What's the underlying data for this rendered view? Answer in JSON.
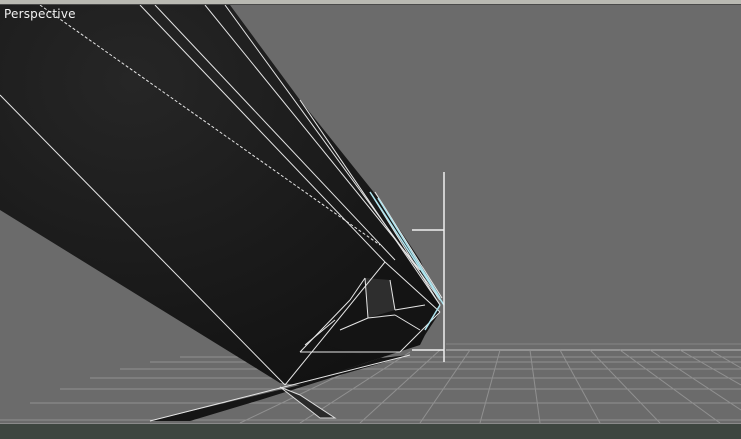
{
  "viewport": {
    "label": "Perspective",
    "background_color": "#6b6b6b",
    "grid_color": "#9a9a9a",
    "mesh_fill_color": "#1a1a1a",
    "wire_color": "#e6e6e6"
  }
}
